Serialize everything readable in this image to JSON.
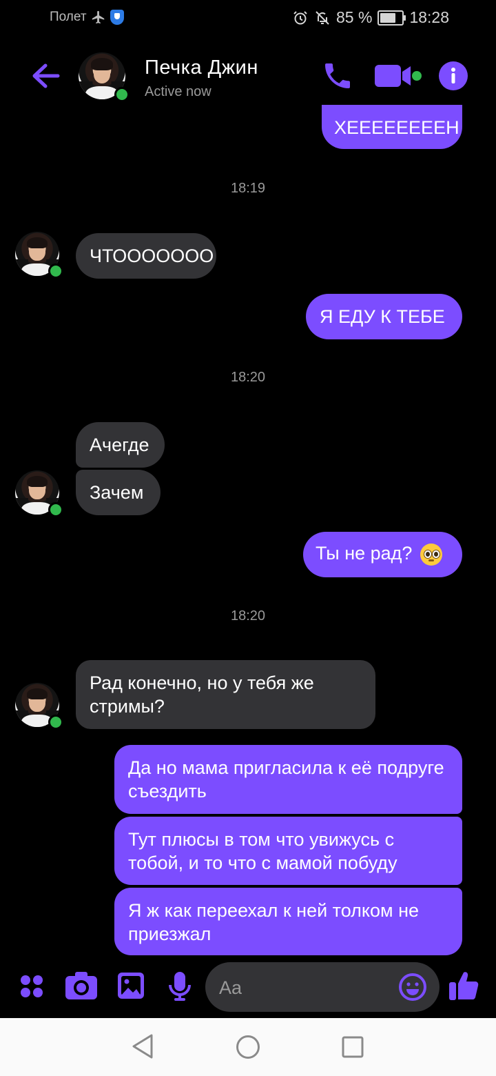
{
  "status_bar": {
    "carrier": "Полет",
    "battery": "85 %",
    "battery_level": 0.85,
    "time": "18:28"
  },
  "header": {
    "contact_name": "Печка Джин",
    "contact_status": "Active now"
  },
  "messages": {
    "m1": "ХЕЕЕЕЕЕЕЕН",
    "t1": "18:19",
    "m2": "ЧТООООООО",
    "m3": "Я ЕДУ К ТЕБЕ",
    "t2": "18:20",
    "m4": "Ачегде",
    "m5": "Зачем",
    "m6": "Ты не рад?",
    "t3": "18:20",
    "m7": "Рад конечно, но у тебя же стримы?",
    "m8": "Да но мама пригласила к её подруге съездить",
    "m9": "Тут плюсы в том что увижусь с тобой, и то что с мамой побуду",
    "m10": "Я ж как переехал к ней толком не приезжал"
  },
  "composer": {
    "placeholder": "Aa"
  },
  "colors": {
    "accent": "#7c4dff",
    "incoming_bubble": "#333336",
    "online": "#31b94d"
  },
  "icons": {
    "airplane": "airplane-icon",
    "alarm": "alarm-icon",
    "mute": "bell-off-icon",
    "back": "back-arrow-icon",
    "call": "phone-icon",
    "video": "video-camera-icon",
    "info": "info-icon",
    "apps": "four-dots-icon",
    "camera": "camera-icon",
    "gallery": "image-icon",
    "mic": "microphone-icon",
    "emoji": "smiley-icon",
    "like": "thumbs-up-icon",
    "emoji_in_msg": "pleading-face-emoji"
  }
}
